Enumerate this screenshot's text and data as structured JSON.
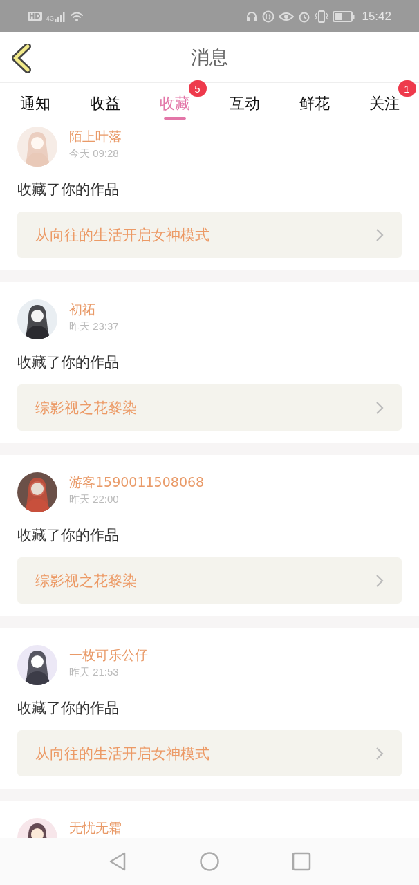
{
  "status_bar": {
    "hd": "HD",
    "network": "4G",
    "time": "15:42"
  },
  "header": {
    "title": "消息"
  },
  "tabs": [
    {
      "label": "通知",
      "selected": false
    },
    {
      "label": "收益",
      "selected": false
    },
    {
      "label": "收藏",
      "selected": true,
      "badge": "5"
    },
    {
      "label": "互动",
      "selected": false
    },
    {
      "label": "鲜花",
      "selected": false
    },
    {
      "label": "关注",
      "selected": false,
      "badge": "1"
    }
  ],
  "messages": [
    {
      "name": "陌上叶落",
      "time": "今天 09:28",
      "action": "收藏了你的作品",
      "work": "从向往的生活开启女神模式"
    },
    {
      "name": "初祏",
      "time": "昨天 23:37",
      "action": "收藏了你的作品",
      "work": "综影视之花黎染"
    },
    {
      "name": "游客1590011508068",
      "time": "昨天 22:00",
      "action": "收藏了你的作品",
      "work": "综影视之花黎染"
    },
    {
      "name": "一枚可乐公仔",
      "time": "昨天 21:53",
      "action": "收藏了你的作品",
      "work": "从向往的生活开启女神模式"
    },
    {
      "name": "无忧无霜"
    }
  ]
}
